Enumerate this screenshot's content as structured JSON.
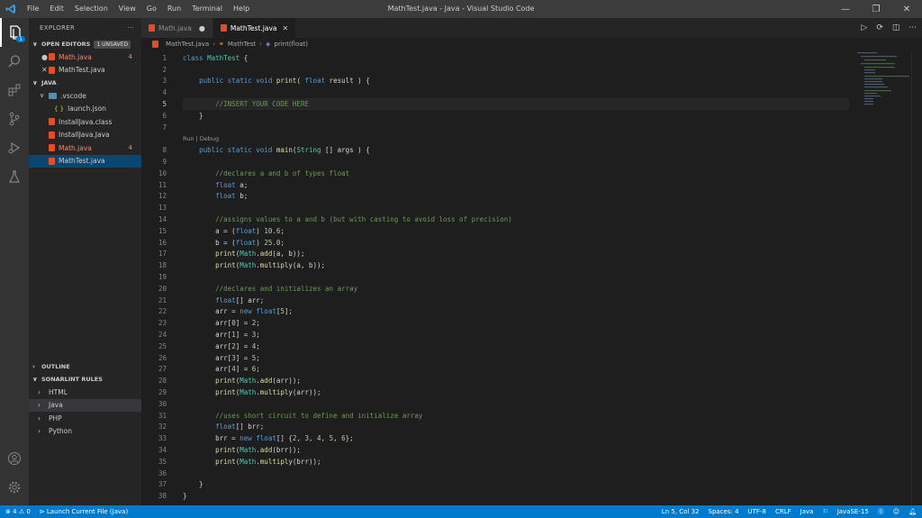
{
  "titlebar": {
    "menu": [
      "File",
      "Edit",
      "Selection",
      "View",
      "Go",
      "Run",
      "Terminal",
      "Help"
    ],
    "window_title": "MathTest.java - Java - Visual Studio Code"
  },
  "sidebar": {
    "title": "EXPLORER",
    "more": "···",
    "open_editors": {
      "label": "OPEN EDITORS",
      "badge": "1 UNSAVED"
    },
    "open_files": [
      {
        "name": "Math.java",
        "count": "4"
      },
      {
        "name": "MathTest.java"
      }
    ],
    "workspace": "JAVA",
    "tree": [
      {
        "name": ".vscode"
      },
      {
        "name": "launch.json"
      },
      {
        "name": "InstallJava.class"
      },
      {
        "name": "InstallJava.Java"
      },
      {
        "name": "Math.java",
        "count": "4"
      },
      {
        "name": "MathTest.java"
      }
    ],
    "outline": "OUTLINE",
    "sonarlint": "SONARLINT RULES",
    "sonar_items": [
      "HTML",
      "Java",
      "PHP",
      "Python"
    ]
  },
  "editor": {
    "tabs": [
      {
        "label": "Math.java",
        "dirty": "●"
      },
      {
        "label": "MathTest.java",
        "close": "✕"
      }
    ],
    "breadcrumb": [
      "MathTest.java",
      "MathTest",
      "print(float)"
    ],
    "codelens": "Run | Debug"
  },
  "code_lines": [
    "class MathTest {",
    "",
    "    public static void print( float result ) {",
    "",
    "        //INSERT YOUR CODE HERE",
    "    }",
    "",
    "    public static void main(String [] args ) {",
    "",
    "        //declares a and b of types float",
    "        float a;",
    "        float b;",
    "",
    "        //assigns values to a and b (but with casting to avoid loss of precision)",
    "        a = (float) 10.6;",
    "        b = (float) 25.0;",
    "        print(Math.add(a, b));",
    "        print(Math.multiply(a, b));",
    "",
    "        //declares and initializes an array",
    "        float[] arr;",
    "        arr = new float[5];",
    "        arr[0] = 2;",
    "        arr[1] = 3;",
    "        arr[2] = 4;",
    "        arr[3] = 5;",
    "        arr[4] = 6;",
    "        print(Math.add(arr));",
    "        print(Math.multiply(arr));",
    "",
    "        //uses short circuit to define and initialize array",
    "        float[] brr;",
    "        brr = new float[] {2, 3, 4, 5, 6};",
    "        print(Math.add(brr));",
    "        print(Math.multiply(brr));",
    "",
    "    }",
    "}"
  ],
  "statusbar": {
    "errors": "4",
    "warnings": "0",
    "launch": "Launch Current File (Java)",
    "position": "Ln 5, Col 32",
    "spaces": "Spaces: 4",
    "encoding": "UTF-8",
    "eol": "CRLF",
    "language": "Java",
    "jdk": "JavaSE-15"
  }
}
